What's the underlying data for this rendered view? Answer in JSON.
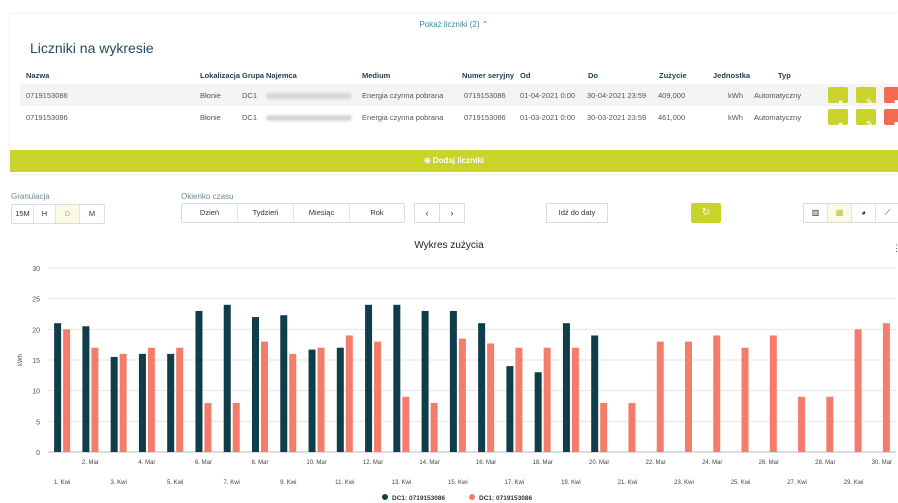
{
  "meters_panel": {
    "toggle_label": "Pokaż liczniki (2) ⌃",
    "title": "Liczniki na wykresie",
    "columns": [
      "Nazwa",
      "Lokalizacja",
      "Grupa",
      "Najemca",
      "Medium",
      "Numer seryjny",
      "Od",
      "Do",
      "Zużycie",
      "Jednostka",
      "Typ"
    ],
    "rows": [
      {
        "nazwa": "0719153086",
        "lokalizacja": "Błonie",
        "grupa": "DC1",
        "medium": "Energia czynna pobrana",
        "numer": "0719153086",
        "od": "01-04-2021 0:00",
        "do": "30-04-2021 23:59",
        "zuzycie": "409,000",
        "jednostka": "kWh",
        "typ": "Automatyczny"
      },
      {
        "nazwa": "0719153086",
        "lokalizacja": "Błonie",
        "grupa": "DC1",
        "medium": "Energia czynna pobrana",
        "numer": "0719153086",
        "od": "01-03-2021 0:00",
        "do": "30-03-2021 23:59",
        "zuzycie": "461,000",
        "jednostka": "kWh",
        "typ": "Automatyczny"
      }
    ],
    "row_actions": [
      {
        "icon": "info-icon",
        "color": "#c9d32b"
      },
      {
        "icon": "edit-icon",
        "color": "#c9d32b"
      },
      {
        "icon": "trash-icon",
        "color": "#f26a4f"
      }
    ],
    "add_button": "⊕ Dodaj liczniki"
  },
  "controls": {
    "granulation_label": "Granulacja",
    "granulation_options": [
      "15M",
      "H",
      "D",
      "M"
    ],
    "granulation_selected": "D",
    "window_label": "Okienko czasu",
    "window_options": [
      "Dzień",
      "Tydzień",
      "Miesiąc",
      "Rok"
    ],
    "prev_label": "‹",
    "next_label": "›",
    "goto_date_label": "Idź do daty",
    "refresh_icon": "refresh-icon",
    "view_options": [
      "bar-chart-icon",
      "stacked-chart-icon",
      "pie-chart-icon",
      "line-chart-icon"
    ],
    "view_selected": "stacked-chart-icon"
  },
  "chart_data": {
    "type": "bar",
    "title": "Wykres zużycia",
    "ylabel": "kWh",
    "ylim": [
      0,
      30
    ],
    "yticks": [
      0,
      5,
      10,
      15,
      20,
      25,
      30
    ],
    "grid": true,
    "legend_position": "bottom",
    "x_labels_bottom": [
      "1. Kwi",
      "3. Kwi",
      "5. Kwi",
      "7. Kwi",
      "9. Kwi",
      "11. Kwi",
      "13. Kwi",
      "15. Kwi",
      "17. Kwi",
      "19. Kwi",
      "21. Kwi",
      "23. Kwi",
      "25. Kwi",
      "27. Kwi",
      "29. Kwi"
    ],
    "x_labels_top": [
      "2. Mar",
      "4. Mar",
      "6. Mar",
      "8. Mar",
      "10. Mar",
      "12. Mar",
      "14. Mar",
      "16. Mar",
      "18. Mar",
      "20. Mar",
      "22. Mar",
      "24. Mar",
      "26. Mar",
      "28. Mar",
      "30. Mar"
    ],
    "series": [
      {
        "name": "DC1: 0719153086",
        "color": "#0f3d4a",
        "values": [
          21,
          20.5,
          15.5,
          16,
          16,
          23,
          24,
          22,
          22.3,
          16.7,
          17,
          24,
          24,
          23,
          23,
          21,
          14,
          13,
          21,
          19,
          null,
          null,
          null,
          null,
          null,
          null,
          null,
          null,
          null,
          null
        ]
      },
      {
        "name": "DC1: 0719153086",
        "color": "#f47c6b",
        "values": [
          20,
          17,
          16,
          17,
          17,
          8,
          8,
          18,
          16,
          17,
          19,
          18,
          9,
          8,
          18.5,
          17.7,
          17,
          17,
          17,
          8,
          8,
          18,
          18,
          19,
          17,
          19,
          9,
          9,
          20,
          21
        ]
      }
    ]
  }
}
